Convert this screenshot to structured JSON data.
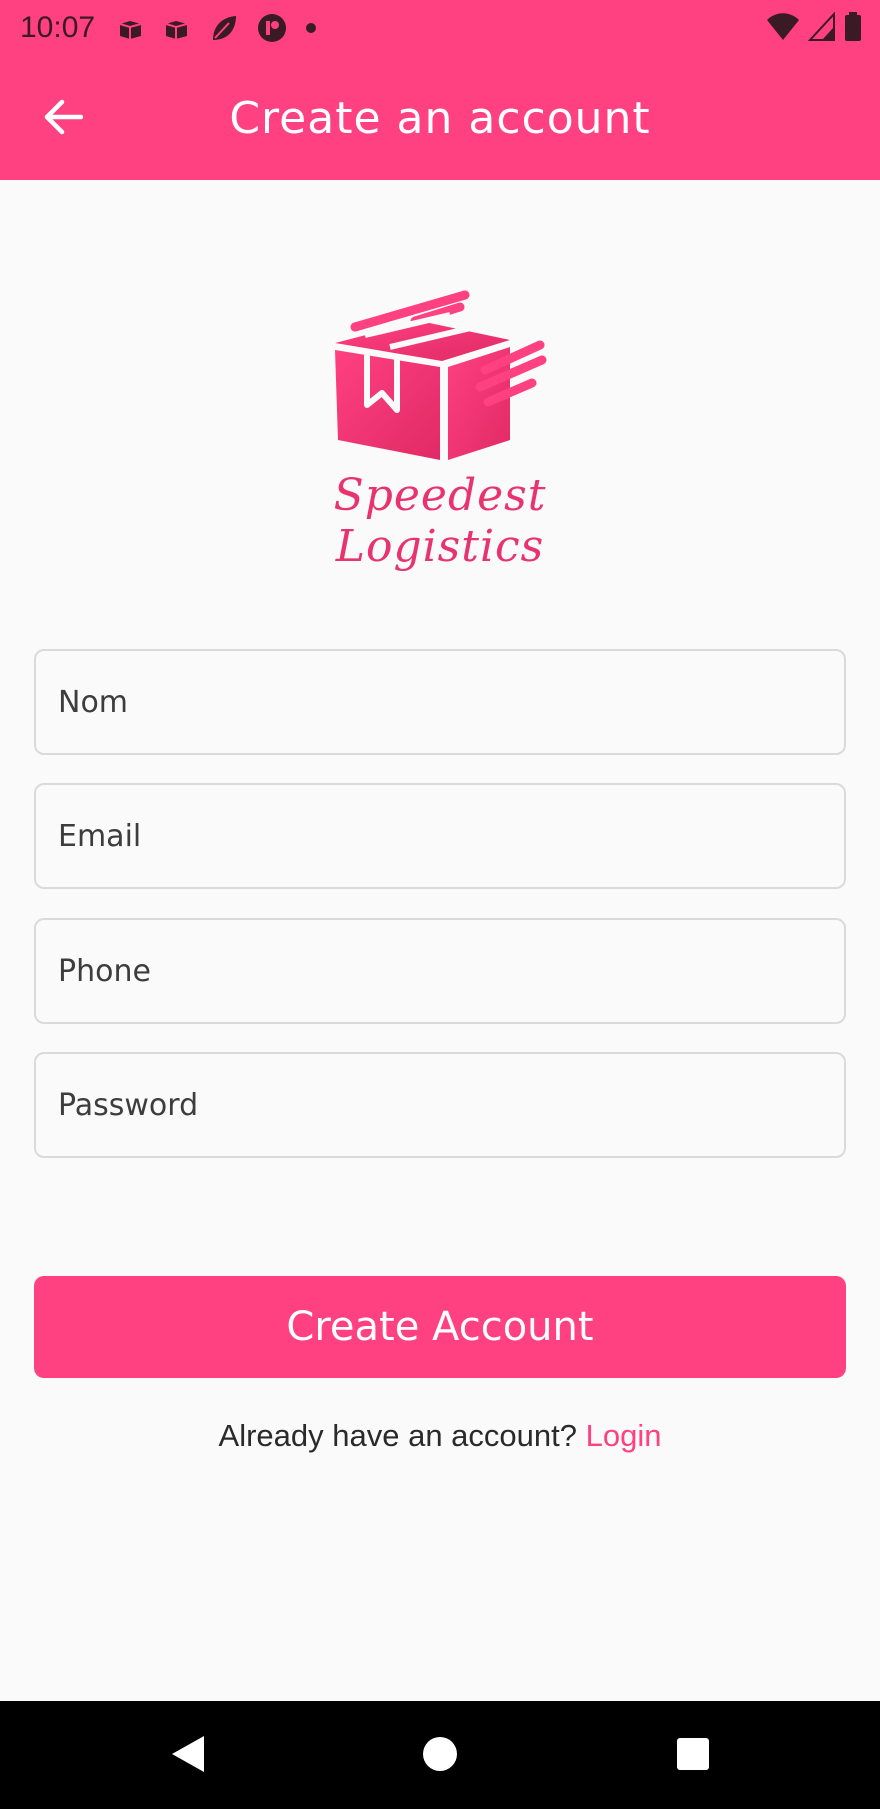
{
  "status_bar": {
    "time": "10:07",
    "icons_left": [
      "box-notification-icon",
      "box-notification-icon",
      "leaf-icon",
      "app-p-icon",
      "dot-icon"
    ],
    "icons_right": [
      "wifi-icon",
      "signal-icon",
      "battery-icon"
    ]
  },
  "app_bar": {
    "title": "Create an account",
    "back_icon": "arrow-back-icon",
    "background": "#ff4081"
  },
  "logo": {
    "brand_text": "Speedest Logistics",
    "color": "#e8336f"
  },
  "form": {
    "nom_placeholder": "Nom",
    "email_placeholder": "Email",
    "phone_placeholder": "Phone",
    "password_placeholder": "Password"
  },
  "create_button": {
    "label": "Create Account",
    "color": "#ff4081"
  },
  "login_prompt": {
    "text": "Already have an account?",
    "link": "Login"
  },
  "nav_bar": {
    "icons": [
      "nav-back-icon",
      "nav-home-icon",
      "nav-recents-icon"
    ]
  }
}
